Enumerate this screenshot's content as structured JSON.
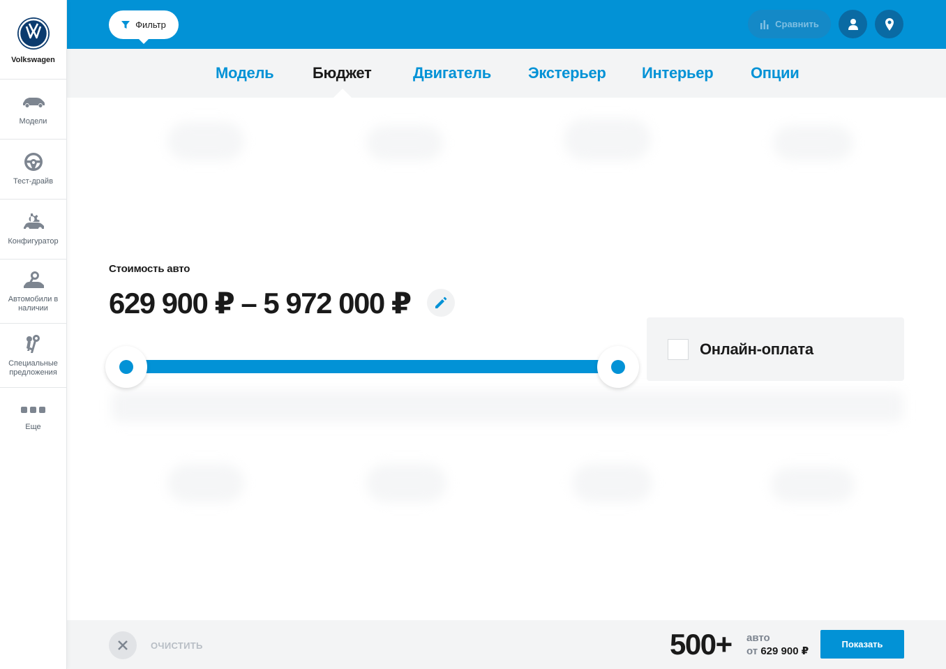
{
  "brand": {
    "name": "Volkswagen",
    "logo_icon": "vw-logo-icon"
  },
  "sidebar": {
    "items": [
      {
        "label": "Модели",
        "icon": "car-icon"
      },
      {
        "label": "Тест-драйв",
        "icon": "steering-wheel-icon"
      },
      {
        "label": "Конфигуратор",
        "icon": "configurator-icon"
      },
      {
        "label": "Автомобили в наличии",
        "icon": "car-search-icon"
      },
      {
        "label": "Специальные предложения",
        "icon": "keys-icon"
      },
      {
        "label": "Еще",
        "icon": "more-dots-icon"
      }
    ]
  },
  "header": {
    "filter_label": "Фильтр",
    "compare_label": "Сравнить",
    "account_icon": "user-icon",
    "location_icon": "location-pin-icon",
    "accent_color": "#0292d6"
  },
  "tabs": [
    {
      "label": "Модель",
      "active": false
    },
    {
      "label": "Бюджет",
      "active": true
    },
    {
      "label": "Двигатель",
      "active": false
    },
    {
      "label": "Экстерьер",
      "active": false
    },
    {
      "label": "Интерьер",
      "active": false
    },
    {
      "label": "Опции",
      "active": false
    }
  ],
  "budget": {
    "label": "Стоимость авто",
    "range_text": "629 900 ₽ – 5 972 000 ₽",
    "min": 629900,
    "max": 5972000,
    "slider_low_fraction": 0,
    "slider_high_fraction": 1
  },
  "online_payment": {
    "label": "Онлайн-оплата",
    "checked": false
  },
  "footer": {
    "clear_label": "ОЧИСТИТЬ",
    "count": "500+",
    "count_unit": "авто",
    "from_prefix": "от",
    "from_price": "629 900 ₽",
    "show_label": "Показать"
  }
}
